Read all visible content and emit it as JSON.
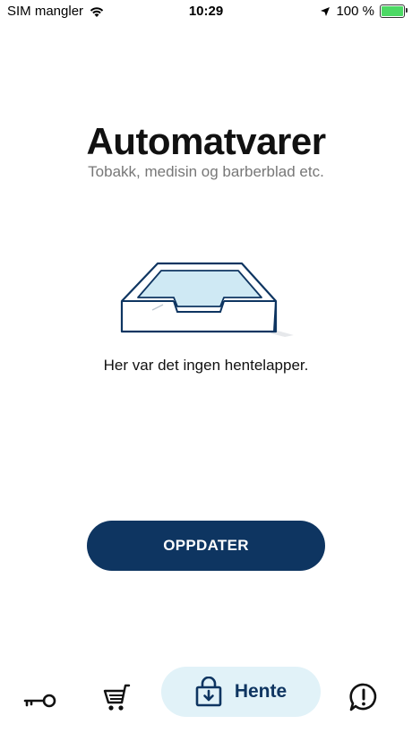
{
  "status_bar": {
    "carrier": "SIM mangler",
    "time": "10:29",
    "battery_percent": "100 %",
    "battery_level": 1.0
  },
  "header": {
    "title": "Automatvarer",
    "subtitle": "Tobakk, medisin og barberblad etc."
  },
  "empty_state": {
    "illustration": "empty-tray",
    "message": "Her var det ingen hentelapper."
  },
  "actions": {
    "refresh_label": "OPPDATER"
  },
  "tab_bar": {
    "items": [
      {
        "icon": "key-icon"
      },
      {
        "icon": "shopping-cart-icon"
      },
      {
        "icon": "locker-download-icon",
        "label": "Hente",
        "active": true
      },
      {
        "icon": "help-icon"
      }
    ]
  },
  "colors": {
    "primary": "#0e3561",
    "active_tab_bg": "#e1f2f8",
    "subtitle": "#777777",
    "battery": "#4cd964"
  }
}
